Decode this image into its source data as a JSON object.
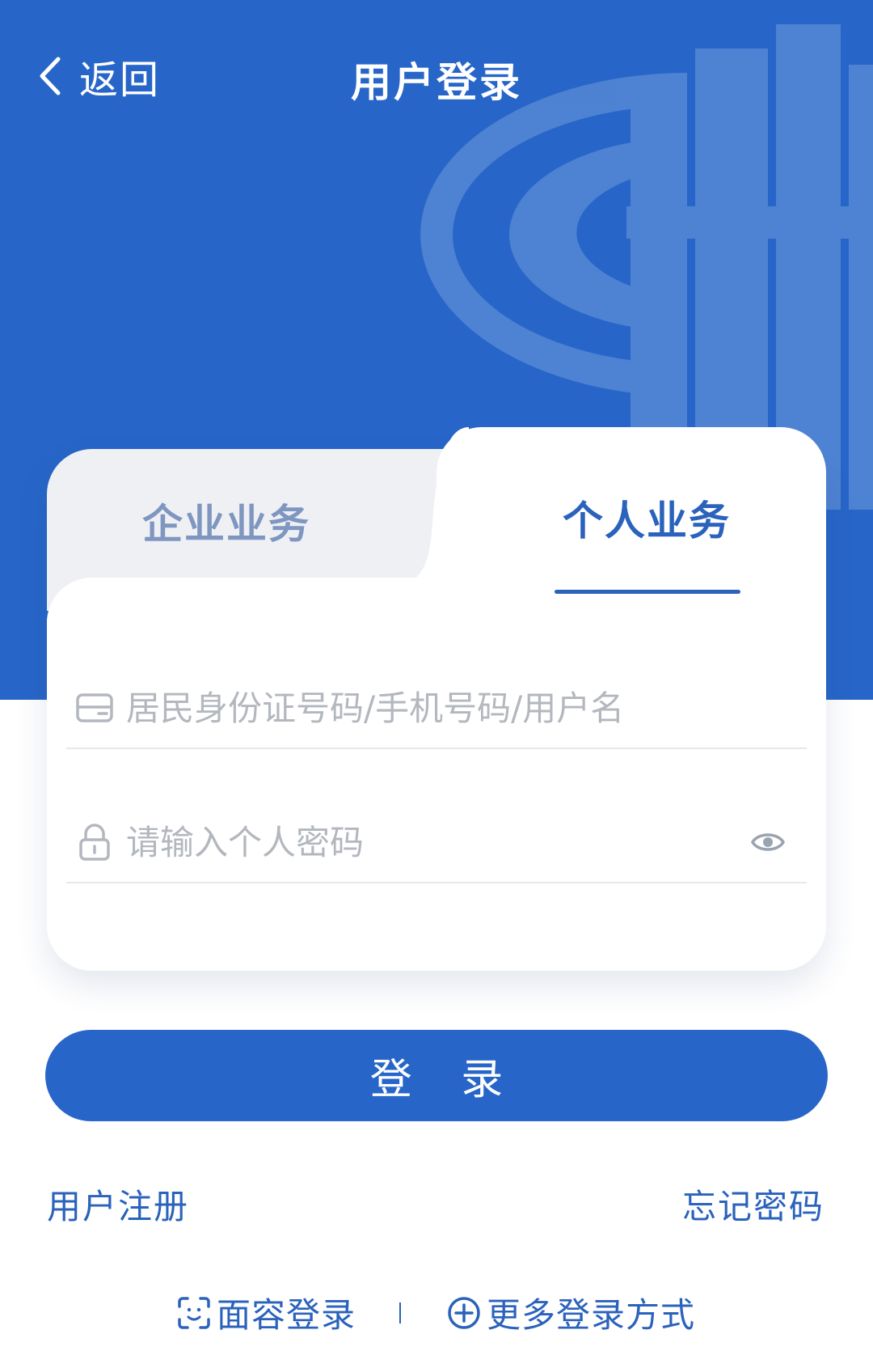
{
  "header": {
    "back_label": "返回",
    "title": "用户登录"
  },
  "tabs": {
    "business": "企业业务",
    "personal": "个人业务",
    "active": "personal"
  },
  "form": {
    "account": {
      "value": "",
      "placeholder": "居民身份证号码/手机号码/用户名",
      "icon": "id-card-icon"
    },
    "password": {
      "value": "",
      "placeholder": "请输入个人密码",
      "icon": "lock-icon",
      "toggle_icon": "eye-icon"
    }
  },
  "actions": {
    "login_label": "登 录",
    "register_label": "用户注册",
    "forgot_label": "忘记密码",
    "face_login_label": "面容登录",
    "more_login_label": "更多登录方式"
  },
  "colors": {
    "primary": "#2766c8",
    "tab_inactive": "#7f96c0",
    "placeholder": "#b3b7be"
  }
}
